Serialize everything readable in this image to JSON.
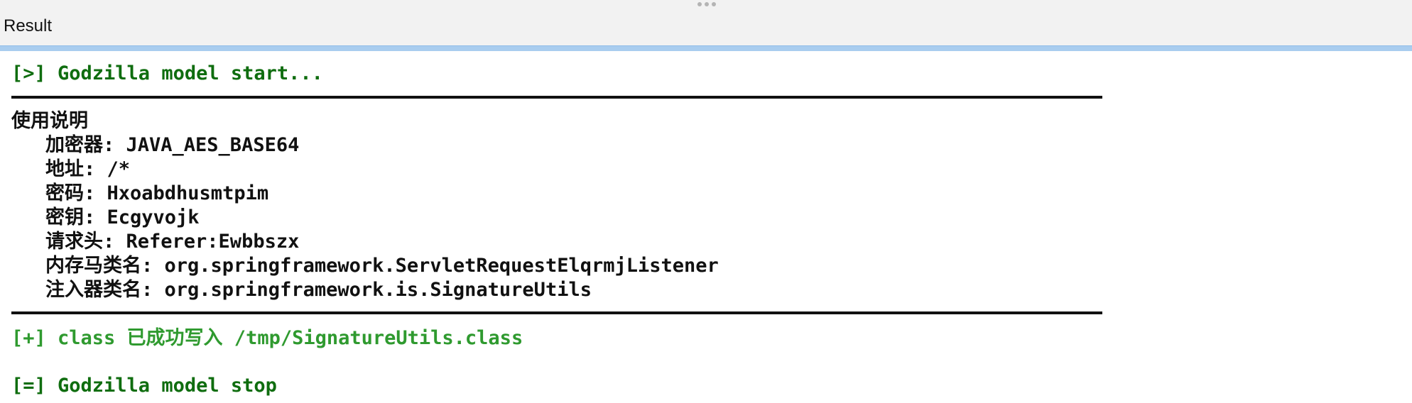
{
  "panel": {
    "title": "Result"
  },
  "console": {
    "start": "[>] Godzilla model start...",
    "usage_title": "使用说明",
    "lines": [
      "加密器: JAVA_AES_BASE64",
      "地址: /*",
      "密码: Hxoabdhusmtpim",
      "密钥: Ecgyvojk",
      "请求头: Referer:Ewbbszx",
      "内存马类名: org.springframework.ServletRequestElqrmjListener",
      "注入器类名: org.springframework.is.SignatureUtils"
    ],
    "success": "[+] class 已成功写入 /tmp/SignatureUtils.class",
    "stop": "[=] Godzilla model stop"
  },
  "colors": {
    "dark_green": "#0f6d0f",
    "green": "#2f9a2f",
    "accent": "#a9cdef"
  }
}
